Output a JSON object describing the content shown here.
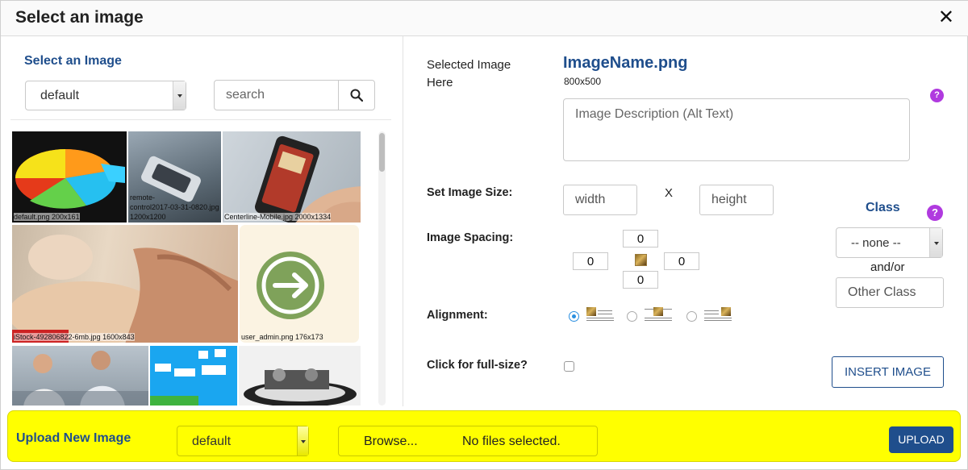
{
  "dialog": {
    "title": "Select an image",
    "close_glyph": "✕"
  },
  "library": {
    "heading": "Select an Image",
    "folder_value": "default",
    "search_placeholder": "search",
    "thumbnails": [
      {
        "caption": "default.png 200x161"
      },
      {
        "caption_line1": "remote-",
        "caption_line2": "control2017-03-31-0820.jpg",
        "caption_line3": "1200x1200"
      },
      {
        "caption": "Centerline-Mobile.jpg 2000x1334"
      },
      {
        "caption": "iStock-492806822-6mb.jpg 1600x843"
      },
      {
        "caption": "user_admin.png 176x173"
      },
      {
        "caption": ""
      },
      {
        "caption": ""
      },
      {
        "caption": ""
      }
    ]
  },
  "details": {
    "selected_label": "Selected Image Here",
    "image_name": "ImageName.png",
    "image_dimensions": "800x500",
    "alt_placeholder": "Image Description (Alt Text)",
    "size_label": "Set Image Size:",
    "width_placeholder": "width",
    "x_separator": "X",
    "height_placeholder": "height",
    "spacing_label": "Image Spacing:",
    "spacing": {
      "top": "0",
      "left": "0",
      "right": "0",
      "bottom": "0"
    },
    "alignment_label": "Alignment:",
    "alignment_selected": "left",
    "fullsize_label": "Click for full-size?",
    "fullsize_checked": false,
    "class_heading": "Class",
    "class_value": "-- none --",
    "and_or": "and/or",
    "other_class_placeholder": "Other Class",
    "insert_label": "INSERT IMAGE",
    "help_glyph": "?"
  },
  "upload": {
    "heading": "Upload New Image",
    "folder_value": "default",
    "browse_label": "Browse...",
    "file_status": "No files selected.",
    "upload_label": "UPLOAD"
  },
  "colors": {
    "accent": "#1f4e8c",
    "help": "#b03adf",
    "upload_bar": "#ffff00",
    "radio_selected": "#2a8fe0"
  }
}
